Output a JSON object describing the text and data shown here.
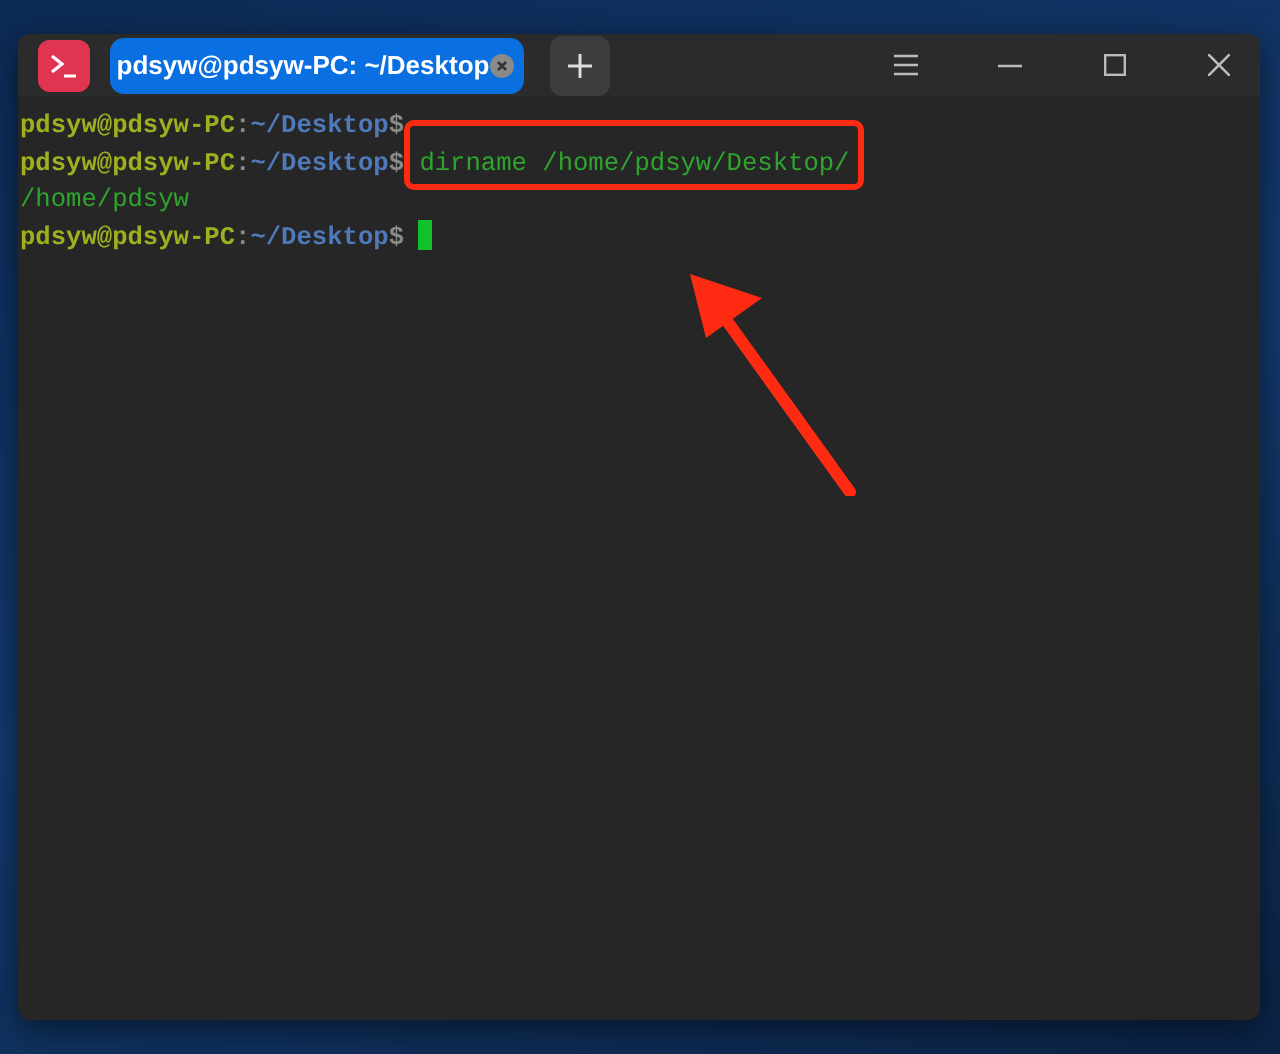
{
  "window": {
    "tab_title": "pdsyw@pdsyw-PC: ~/Desktop"
  },
  "lines": [
    {
      "kind": "prompt",
      "user_host": "pdsyw@pdsyw-PC",
      "separator": ":",
      "path": "~/Desktop",
      "symbol": "$"
    },
    {
      "kind": "prompt",
      "user_host": "pdsyw@pdsyw-PC",
      "separator": ":",
      "path": "~/Desktop",
      "symbol": "$",
      "command": "dirname /home/pdsyw/Desktop/",
      "highlighted": true
    },
    {
      "kind": "output",
      "text": "/home/pdsyw"
    },
    {
      "kind": "prompt",
      "user_host": "pdsyw@pdsyw-PC",
      "separator": ":",
      "path": "~/Desktop",
      "symbol": "$",
      "cursor": true
    }
  ]
}
